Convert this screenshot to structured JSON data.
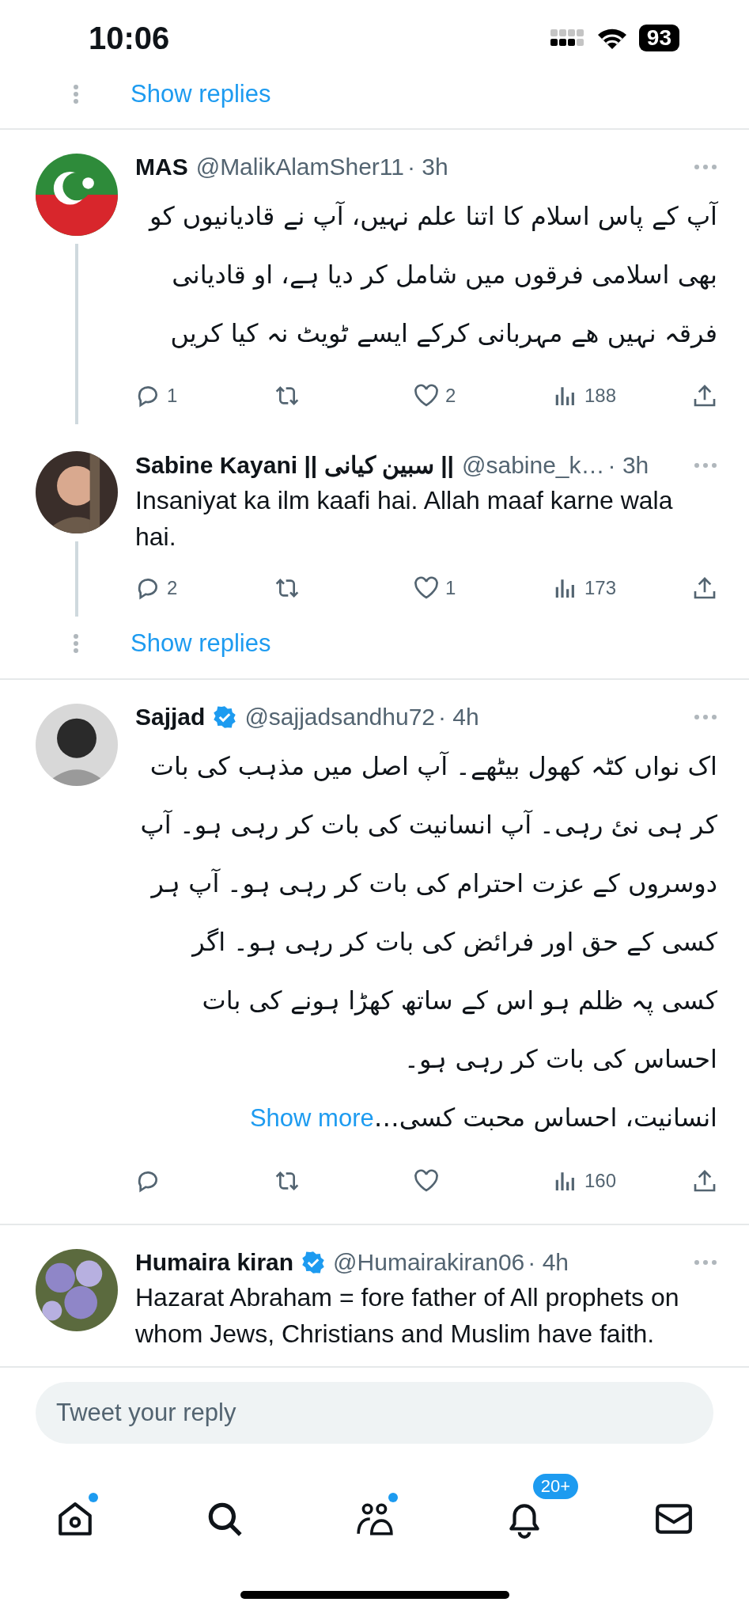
{
  "status_bar": {
    "time": "10:06",
    "battery": "93"
  },
  "top_show_replies": "Show replies",
  "tweets": [
    {
      "name": "MAS",
      "verified": false,
      "handle": "@MalikAlamSher11",
      "time": "· 3h",
      "rtl": true,
      "text": "آپ کے پاس اسلام کا اتنا علم نہیں، آپ نے قادیانیوں کو بھی اسلامی فرقوں میں شامل کر دیا ہے، او قادیانی فرقہ نہیں ھے مہربانی کرکے ایسے ٹویٹ نہ کیا کریں",
      "replies": "1",
      "likes": "2",
      "views": "188",
      "thread_line": true
    },
    {
      "name": "Sabine Kayani || سبین کیانی ||",
      "verified": false,
      "handle": "@sabine_k…",
      "time": "· 3h",
      "rtl": false,
      "text": "Insaniyat ka ilm kaafi hai. Allah maaf karne wala hai.",
      "replies": "2",
      "likes": "1",
      "views": "173",
      "thread_line": true,
      "show_replies": "Show replies"
    },
    {
      "name": "Sajjad",
      "verified": true,
      "handle": "@sajjadsandhu72",
      "time": "· 4h",
      "rtl": true,
      "text": "اک نواں کٹہ کھول بیٹھے۔  آپ اصل میں مذہب کی بات کر ہی نئ رہی۔ آپ انسانیت کی بات کر رہی ہو۔ آپ دوسروں کے عزت احترام کی بات کر رہی ہو۔ آپ ہر کسی کے حق اور فرائض کی بات کر رہی ہو۔  اگر کسی پہ ظلم ہو اس کے ساتھ کھڑا ہونے کی بات احساس کی بات کر رہی ہو۔\nانسانیت، احساس  محبت کسی…",
      "show_more": "Show more",
      "views": "160",
      "thread_line": false
    },
    {
      "name": "Humaira kiran",
      "verified": true,
      "handle": "@Humairakiran06",
      "time": "· 4h",
      "rtl": false,
      "text": "Hazarat Abraham = fore father of All prophets on whom Jews, Christians and Muslim have faith.",
      "thread_line": false
    }
  ],
  "reply_field": {
    "placeholder": "Tweet your reply"
  },
  "nav": [
    {
      "kind": "home",
      "dot": true
    },
    {
      "kind": "search",
      "dot": false
    },
    {
      "kind": "communities",
      "dot": true
    },
    {
      "kind": "notifications",
      "dot": false,
      "badge": "20+"
    },
    {
      "kind": "messages",
      "dot": false
    }
  ]
}
